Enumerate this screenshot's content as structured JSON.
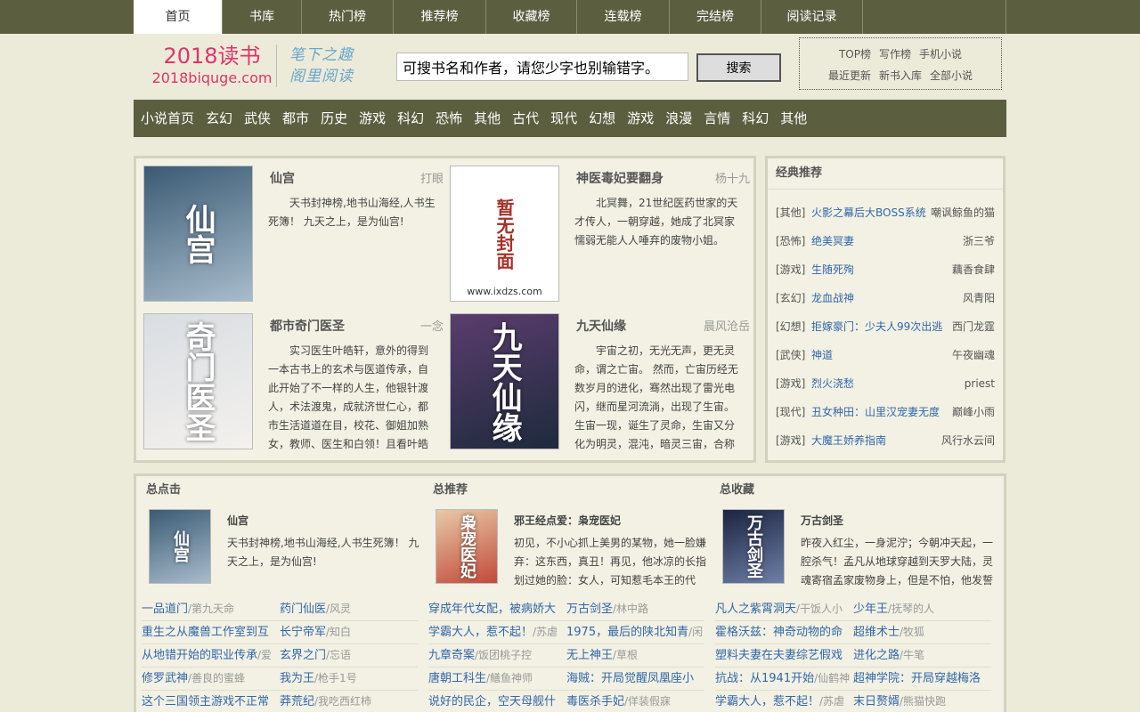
{
  "topnav": [
    "首页",
    "书库",
    "热门榜",
    "推荐榜",
    "收藏榜",
    "连载榜",
    "完结榜",
    "阅读记录"
  ],
  "logo": {
    "title": "2018读书",
    "domain": "2018biquge.com"
  },
  "slogan": [
    "笔下之趣",
    "阁里阅读"
  ],
  "search": {
    "value": "可搜书名和作者，请您少字也别输错字。",
    "button": "搜索"
  },
  "quick": {
    "row1": [
      "TOP榜",
      "写作榜",
      "手机小说"
    ],
    "row2": [
      "最近更新",
      "新书入库",
      "全部小说"
    ]
  },
  "categories": [
    "小说首页",
    "玄幻",
    "武侠",
    "都市",
    "历史",
    "游戏",
    "科幻",
    "恐怖",
    "其他",
    "古代",
    "现代",
    "幻想",
    "游戏",
    "浪漫",
    "言情",
    "科幻",
    "其他"
  ],
  "hot_books": [
    {
      "name": "仙宫",
      "author": "打眼",
      "desc": "天书封神榜,地书山海经,人书生死簿！ 九天之上，是为仙宫!",
      "cover_text": "仙宫",
      "cover_colors": [
        "#3b5b74",
        "#a8bccb"
      ]
    },
    {
      "name": "神医毒妃要翻身",
      "author": "杨十九",
      "desc": "北冥舞，21世纪医药世家的天才传人，一朝穿越，她成了北冥家懦弱无能人人唾弃的废物小姐。",
      "cover_text": "暂无封面",
      "cover_site": "www.ixdzs.com",
      "cover_colors": [
        "#ffffff",
        "#ffffff"
      ]
    },
    {
      "name": "都市奇门医圣",
      "author": "一念",
      "desc": "实习医生叶皓轩，意外的得到一本古书上的玄术与医道传承，自此开始了不一样的人生，他银针渡人，术法渡鬼，成就济世仁心，都市生活道道在目，校花、御姐加熟女，教师、医生和白领！且看叶皓轩如何纵横都市。",
      "cover_text": "奇门医圣",
      "cover_colors": [
        "#d9dde2",
        "#f4f1ee"
      ]
    },
    {
      "name": "九天仙缘",
      "author": "晨风沧岳",
      "desc": "宇宙之初，无光无声，更无灵命，谓之亡宙。 然而，亡宙历经无数岁月的进化，骞然出现了雷光电闪，继而星河流淌，出现了生宙。生宙一现，诞生了灵命，生宙又分化为明灵，混沌，暗灵三宙，合称三灵之宙。",
      "cover_text": "九天仙缘",
      "cover_colors": [
        "#5a3d6e",
        "#1e2a3b"
      ]
    }
  ],
  "classic": {
    "title": "经典推荐",
    "items": [
      {
        "cat": "[其他]",
        "name": "火影之幕后大BOSS系统",
        "author": "嘲讽鲸鱼的猫"
      },
      {
        "cat": "[恐怖]",
        "name": "绝美冥妻",
        "author": "浙三爷"
      },
      {
        "cat": "[游戏]",
        "name": "生随死殉",
        "author": "藕香食肆"
      },
      {
        "cat": "[玄幻]",
        "name": "龙血战神",
        "author": "风青阳"
      },
      {
        "cat": "[幻想]",
        "name": "拒嫁豪门：少夫人99次出逃",
        "author": "西门龙霆"
      },
      {
        "cat": "[武侠]",
        "name": "神道",
        "author": "午夜幽魂"
      },
      {
        "cat": "[游戏]",
        "name": "烈火浇愁",
        "author": "priest"
      },
      {
        "cat": "[现代]",
        "name": "丑女种田：山里汉宠妻无度",
        "author": "巅峰小雨"
      },
      {
        "cat": "[游戏]",
        "name": "大魔王娇养指南",
        "author": "风行水云间"
      }
    ]
  },
  "bottom": [
    {
      "title": "总点击",
      "feat": {
        "name": "仙宫",
        "desc": "天书封神榜,地书山海经,人书生死簿！ 九天之上，是为仙宫!",
        "cover_text": "仙宫",
        "cover_colors": [
          "#3b5b74",
          "#a8bccb"
        ]
      },
      "list": [
        {
          "t": "一品道门",
          "a": "/第九天命"
        },
        {
          "t": "药门仙医",
          "a": "/风灵"
        },
        {
          "t": "重生之从魔兽工作室到互",
          "a": ""
        },
        {
          "t": "长宁帝军",
          "a": "/知白"
        },
        {
          "t": "从地错开始的职业传承",
          "a": "/爱"
        },
        {
          "t": "玄界之门",
          "a": "/忘语"
        },
        {
          "t": "修罗武神",
          "a": "/善良的蜜蜂"
        },
        {
          "t": "我为王",
          "a": "/枪手1号"
        },
        {
          "t": "这个三国领主游戏不正常",
          "a": ""
        },
        {
          "t": "莽荒纪",
          "a": "/我吃西红柿"
        }
      ]
    },
    {
      "title": "总推荐",
      "feat": {
        "name": "邪王经点爱：枭宠医妃",
        "desc": "初见，不小心抓上美男的某物，她一脸嫌弃：这东西，真丑！再见，他冰凉的长指划过她的脸：女人，可知惹毛本王的代价？",
        "cover_text": "枭宠医妃",
        "cover_colors": [
          "#e9c9a7",
          "#c24a3a"
        ]
      },
      "list": [
        {
          "t": "穿成年代女配，被病娇大",
          "a": ""
        },
        {
          "t": "万古剑圣",
          "a": "/林中路"
        },
        {
          "t": "学霸大人，惹不起！",
          "a": "/苏虐"
        },
        {
          "t": "1975，最后的陕北知青",
          "a": "/闲"
        },
        {
          "t": "九章奇案",
          "a": "/饭团桃子控"
        },
        {
          "t": "无上神王",
          "a": "/草根"
        },
        {
          "t": "唐朝工科生",
          "a": "/鳝鱼神师"
        },
        {
          "t": "海贼：开局觉醒凤凰座小",
          "a": ""
        },
        {
          "t": "说好的民企，空天母舰什",
          "a": ""
        },
        {
          "t": "毒医杀手妃",
          "a": "/佯装假寐"
        }
      ]
    },
    {
      "title": "总收藏",
      "feat": {
        "name": "万古剑圣",
        "desc": "昨夜入红尘，一身泥泞；今朝冲天起，一腔杀气！孟凡从地球穿越到天罗大陆，灵魂寄宿孟家废物身上，但是不怕，他发誓要成为万古剑圣！",
        "cover_text": "万古剑圣",
        "cover_colors": [
          "#1c2540",
          "#6d7fa8"
        ]
      },
      "list": [
        {
          "t": "凡人之紫霄洞天",
          "a": "/干饭人小"
        },
        {
          "t": "少年王",
          "a": "/抚琴的人"
        },
        {
          "t": "霍格沃兹：神奇动物的命",
          "a": ""
        },
        {
          "t": "超维术士",
          "a": "/牧狐"
        },
        {
          "t": "塑料夫妻在夫妻综艺假戏",
          "a": ""
        },
        {
          "t": "进化之路",
          "a": "/牛笔"
        },
        {
          "t": "抗战：从1941开始",
          "a": "/仙鹤神"
        },
        {
          "t": "超神学院：开局穿越梅洛",
          "a": ""
        },
        {
          "t": "学霸大人，惹不起！",
          "a": "/苏虐"
        },
        {
          "t": "末日赘婿",
          "a": "/熊猫快跑"
        }
      ]
    }
  ]
}
